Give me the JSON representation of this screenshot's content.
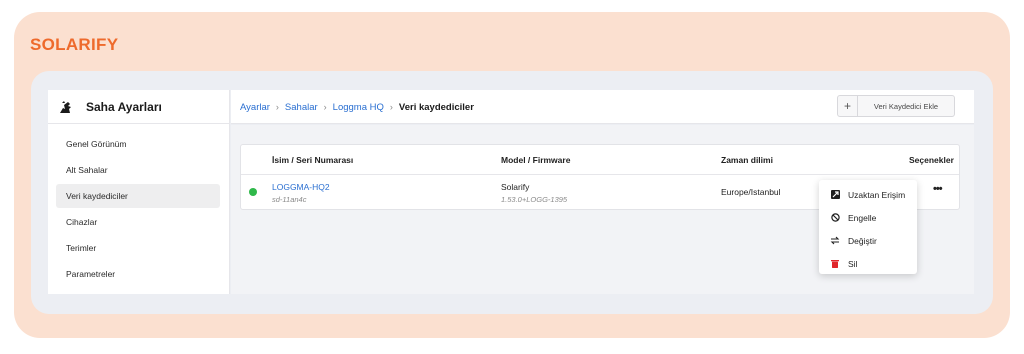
{
  "brand": "SOLARIFY",
  "sidebar": {
    "title": "Saha Ayarları",
    "items": [
      {
        "label": "Genel Görünüm"
      },
      {
        "label": "Alt Sahalar"
      },
      {
        "label": "Veri kaydediciler"
      },
      {
        "label": "Cihazlar"
      },
      {
        "label": "Terimler"
      },
      {
        "label": "Parametreler"
      }
    ],
    "active_index": 2
  },
  "breadcrumb": {
    "items": [
      "Ayarlar",
      "Sahalar",
      "Loggma HQ"
    ],
    "current": "Veri kaydediciler",
    "separator": "›"
  },
  "toolbar": {
    "add_icon": "+",
    "add_label": "Veri Kaydedici Ekle"
  },
  "table": {
    "headers": {
      "name": "İsim / Seri Numarası",
      "model": "Model / Firmware",
      "timezone": "Zaman dilimi",
      "options": "Seçenekler"
    },
    "rows": [
      {
        "status_color": "#2fb84a",
        "name": "LOGGMA-HQ2",
        "serial": "sd-11an4c",
        "model": "Solarify",
        "firmware": "1.53.0+LOGG-1395",
        "timezone": "Europe/Istanbul",
        "more": "•••"
      }
    ]
  },
  "menu": {
    "items": [
      {
        "label": "Uzaktan Erişim",
        "icon": "remote-access-icon"
      },
      {
        "label": "Engelle",
        "icon": "block-icon"
      },
      {
        "label": "Değiştir",
        "icon": "swap-icon"
      },
      {
        "label": "Sil",
        "icon": "trash-icon",
        "icon_color": "#e0262b"
      }
    ]
  },
  "colors": {
    "brand": "#ee6a2c",
    "link": "#2a6fd1",
    "outer_bg": "#fbe0d0",
    "panel_bg": "#eceef3"
  }
}
